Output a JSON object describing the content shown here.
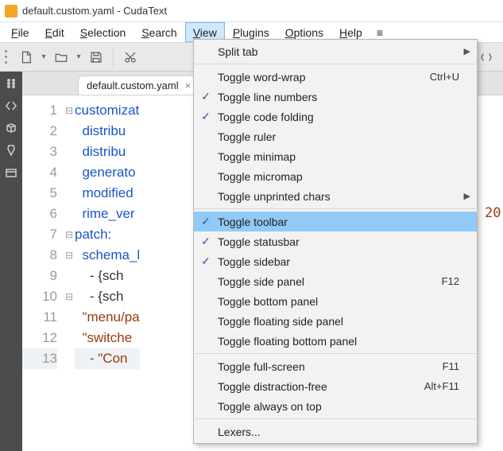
{
  "window": {
    "title": "default.custom.yaml - CudaText"
  },
  "menubar": {
    "items": [
      {
        "label": "File",
        "accel_index": 0
      },
      {
        "label": "Edit",
        "accel_index": 0
      },
      {
        "label": "Selection",
        "accel_index": 0
      },
      {
        "label": "Search",
        "accel_index": 0
      },
      {
        "label": "View",
        "accel_index": 0,
        "active": true
      },
      {
        "label": "Plugins",
        "accel_index": 0
      },
      {
        "label": "Options",
        "accel_index": 0
      },
      {
        "label": "Help",
        "accel_index": 0
      }
    ],
    "overflow_glyph": "≡"
  },
  "toolbar": {
    "new_tip": "New file",
    "open_tip": "Open file",
    "save_tip": "Save file",
    "cut_tip": "Cut"
  },
  "tabbar": {
    "tabs": [
      {
        "label": "default.custom.yaml",
        "close_glyph": "×"
      }
    ]
  },
  "editor": {
    "lines": [
      {
        "num": "1",
        "fold": "⊟",
        "cls": "kw",
        "text": "customizat"
      },
      {
        "num": "2",
        "fold": "",
        "cls": "kw",
        "text": "  distribu"
      },
      {
        "num": "3",
        "fold": "",
        "cls": "kw",
        "text": "  distribu"
      },
      {
        "num": "4",
        "fold": "",
        "cls": "kw",
        "text": "  generato"
      },
      {
        "num": "5",
        "fold": "",
        "cls": "kw",
        "text": "  modified"
      },
      {
        "num": "6",
        "fold": "",
        "cls": "kw",
        "text": "  rime_ver"
      },
      {
        "num": "7",
        "fold": "⊟",
        "cls": "kw",
        "text": "patch:"
      },
      {
        "num": "8",
        "fold": "⊟",
        "cls": "kw",
        "text": "  schema_l"
      },
      {
        "num": "9",
        "fold": "",
        "cls": "plain",
        "text": "    - {sch"
      },
      {
        "num": "10",
        "fold": "⊟",
        "cls": "plain",
        "text": "    - {sch"
      },
      {
        "num": "11",
        "fold": "",
        "cls": "str",
        "text": "  \"menu/pa"
      },
      {
        "num": "12",
        "fold": "",
        "cls": "str",
        "text": "  \"switche"
      },
      {
        "num": "13",
        "fold": "",
        "cls": "str",
        "text": "    - \"Con",
        "caret": true
      }
    ]
  },
  "peek_text": "20",
  "view_menu": {
    "groups": [
      [
        {
          "label": "Split tab",
          "submenu": true
        }
      ],
      [
        {
          "label": "Toggle word-wrap",
          "shortcut": "Ctrl+U"
        },
        {
          "label": "Toggle line numbers",
          "checked": true
        },
        {
          "label": "Toggle code folding",
          "checked": true
        },
        {
          "label": "Toggle ruler"
        },
        {
          "label": "Toggle minimap"
        },
        {
          "label": "Toggle micromap"
        },
        {
          "label": "Toggle unprinted chars",
          "submenu": true
        }
      ],
      [
        {
          "label": "Toggle toolbar",
          "checked": true,
          "highlight": true
        },
        {
          "label": "Toggle statusbar",
          "checked": true
        },
        {
          "label": "Toggle sidebar",
          "checked": true
        },
        {
          "label": "Toggle side panel",
          "shortcut": "F12"
        },
        {
          "label": "Toggle bottom panel"
        },
        {
          "label": "Toggle floating side panel"
        },
        {
          "label": "Toggle floating bottom panel"
        }
      ],
      [
        {
          "label": "Toggle full-screen",
          "shortcut": "F11"
        },
        {
          "label": "Toggle distraction-free",
          "shortcut": "Alt+F11"
        },
        {
          "label": "Toggle always on top"
        }
      ],
      [
        {
          "label": "Lexers..."
        }
      ]
    ]
  }
}
